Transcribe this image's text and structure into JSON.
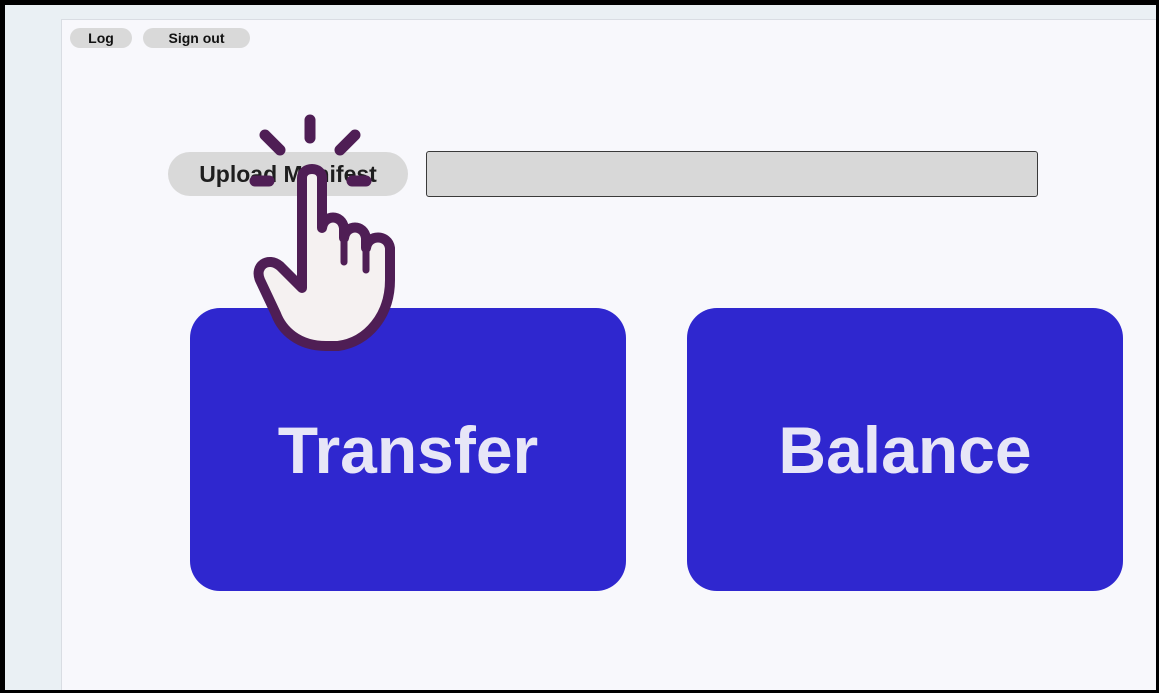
{
  "header": {
    "log_label": "Log",
    "signout_label": "Sign out"
  },
  "upload": {
    "button_label": "Upload Manifest",
    "file_value": ""
  },
  "actions": {
    "transfer_label": "Transfer",
    "balance_label": "Balance"
  },
  "colors": {
    "primary_button": "#2f27cf",
    "primary_button_text": "#e7e6f7",
    "pill_background": "#d9d9d9",
    "cursor_outline": "#4f1e55",
    "cursor_fill": "#f5f1f1"
  },
  "icons": {
    "cursor": "pointing-hand-click-icon"
  }
}
